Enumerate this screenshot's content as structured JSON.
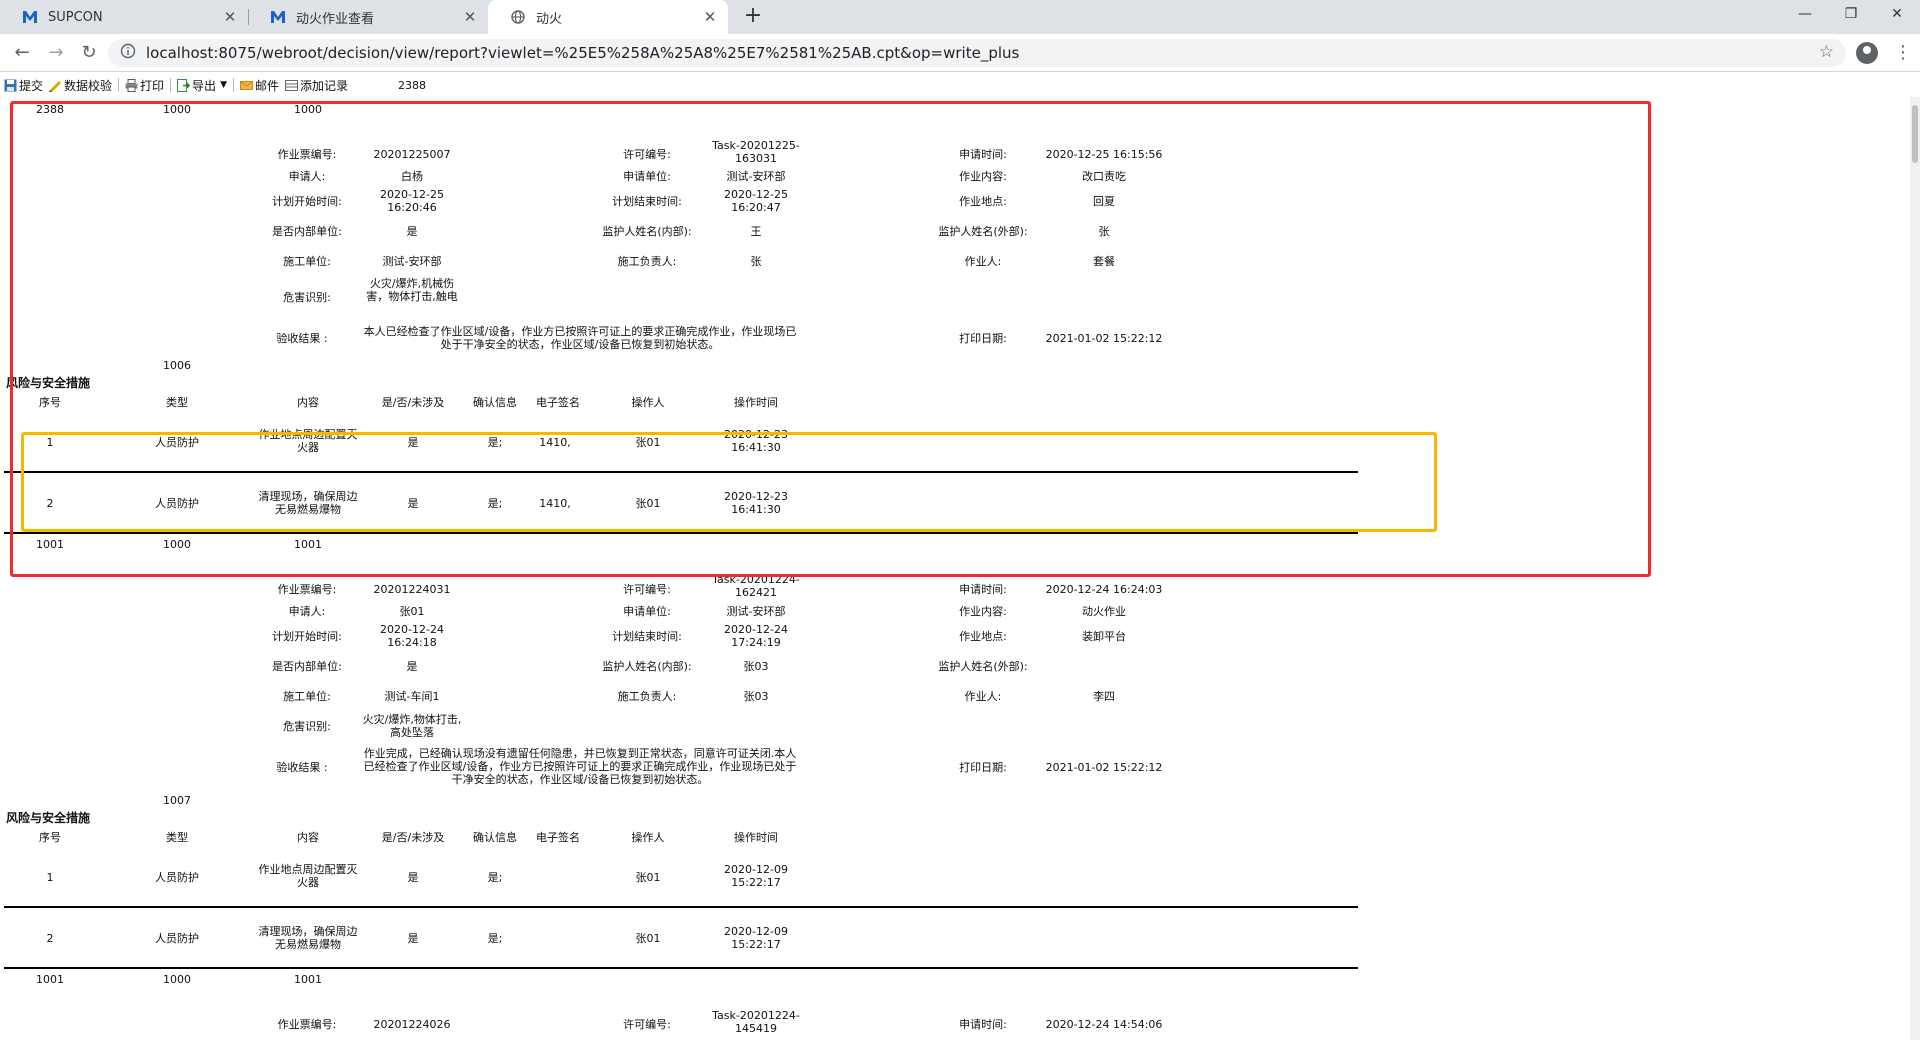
{
  "browser": {
    "tabs": [
      {
        "label": "SUPCON",
        "icon": "m-logo-icon"
      },
      {
        "label": "动火作业查看",
        "icon": "m-logo-icon"
      },
      {
        "label": "动火",
        "icon": "globe-icon"
      }
    ],
    "url": "localhost:8075/webroot/decision/view/report?viewlet=%25E5%258A%25A8%25E7%2581%25AB.cpt&op=write_plus"
  },
  "toolbar": {
    "submit": "提交",
    "validate": "数据校验",
    "print": "打印",
    "export": "导出",
    "mail": "邮件",
    "add_record": "添加记录",
    "page_value": "2388"
  },
  "labels": {
    "ticket_no": "作业票编号:",
    "permit_no": "许可编号:",
    "apply_time": "申请时间:",
    "applicant": "申请人:",
    "apply_unit": "申请单位:",
    "work_content": "作业内容:",
    "plan_start": "计划开始时间:",
    "plan_end": "计划结束时间:",
    "work_location": "作业地点:",
    "is_internal": "是否内部单位:",
    "guardian_internal": "监护人姓名(内部):",
    "guardian_external": "监护人姓名(外部):",
    "construction_unit": "施工单位:",
    "construction_lead": "施工负责人:",
    "worker": "作业人:",
    "hazard": "危害识别:",
    "acceptance": "验收结果 :",
    "print_date": "打印日期:",
    "section_title": "风险与安全措施",
    "col_no": "序号",
    "col_type": "类型",
    "col_content": "内容",
    "col_yes": "是/否/未涉及",
    "col_confirm": "确认信息",
    "col_sign": "电子签名",
    "col_operator": "操作人",
    "col_optime": "操作时间"
  },
  "records": [
    {
      "top_row": [
        "2388",
        "1000",
        "1000"
      ],
      "ticket_no": "20201225007",
      "permit_no": "Task-20201225-163031",
      "apply_time": "2020-12-25 16:15:56",
      "applicant": "白杨",
      "apply_unit": "测试-安环部",
      "work_content": "改口责吃",
      "plan_start": "2020-12-25 16:20:46",
      "plan_end": "2020-12-25 16:20:47",
      "work_location": "回夏",
      "is_internal": "是",
      "guardian_internal": "王",
      "guardian_external": "张",
      "construction_unit": "测试-安环部",
      "construction_lead": "张",
      "worker": "套餐",
      "hazard": "火灾/爆炸,机械伤害，物体打击,触电",
      "acceptance": "本人已经检查了作业区域/设备，作业方已按照许可证上的要求正确完成作业，作业现场已处于干净安全的状态，作业区域/设备已恢复到初始状态。",
      "print_date": "2021-01-02 15:22:12",
      "mid_number": "1006",
      "rows": [
        {
          "no": "1",
          "type": "人员防护",
          "content": "作业地点周边配置灭火器",
          "yes": "是",
          "confirm": "是;",
          "sign": "1410,",
          "operator": "张01",
          "time": "2020-12-23 16:41:30"
        },
        {
          "no": "2",
          "type": "人员防护",
          "content": "清理现场，确保周边无易燃易爆物",
          "yes": "是",
          "confirm": "是;",
          "sign": "1410,",
          "operator": "张01",
          "time": "2020-12-23 16:41:30"
        }
      ],
      "bottom_row": [
        "1001",
        "1000",
        "1001"
      ]
    },
    {
      "ticket_no": "20201224031",
      "permit_no": "Task-20201224-162421",
      "apply_time": "2020-12-24 16:24:03",
      "applicant": "张01",
      "apply_unit": "测试-安环部",
      "work_content": "动火作业",
      "plan_start": "2020-12-24 16:24:18",
      "plan_end": "2020-12-24 17:24:19",
      "work_location": "装卸平台",
      "is_internal": "是",
      "guardian_internal": "张03",
      "guardian_external": "",
      "construction_unit": "测试-车间1",
      "construction_lead": "张03",
      "worker": "李四",
      "hazard": "火灾/爆炸,物体打击,高处坠落",
      "acceptance": "作业完成，已经确认现场没有遗留任何隐患，并已恢复到正常状态，同意许可证关闭.本人已经检查了作业区域/设备，作业方已按照许可证上的要求正确完成作业，作业现场已处于干净安全的状态，作业区域/设备已恢复到初始状态。",
      "print_date": "2021-01-02 15:22:12",
      "mid_number": "1007",
      "rows": [
        {
          "no": "1",
          "type": "人员防护",
          "content": "作业地点周边配置灭火器",
          "yes": "是",
          "confirm": "是;",
          "sign": "",
          "operator": "张01",
          "time": "2020-12-09 15:22:17"
        },
        {
          "no": "2",
          "type": "人员防护",
          "content": "清理现场，确保周边无易燃易爆物",
          "yes": "是",
          "confirm": "是;",
          "sign": "",
          "operator": "张01",
          "time": "2020-12-09 15:22:17"
        }
      ],
      "bottom_row": [
        "1001",
        "1000",
        "1001"
      ]
    },
    {
      "ticket_no": "20201224026",
      "permit_no": "Task-20201224-145419",
      "apply_time": "2020-12-24 14:54:06"
    }
  ],
  "colors": {
    "highlight_red": "#ef2b2b",
    "highlight_yellow": "#f5b800"
  }
}
